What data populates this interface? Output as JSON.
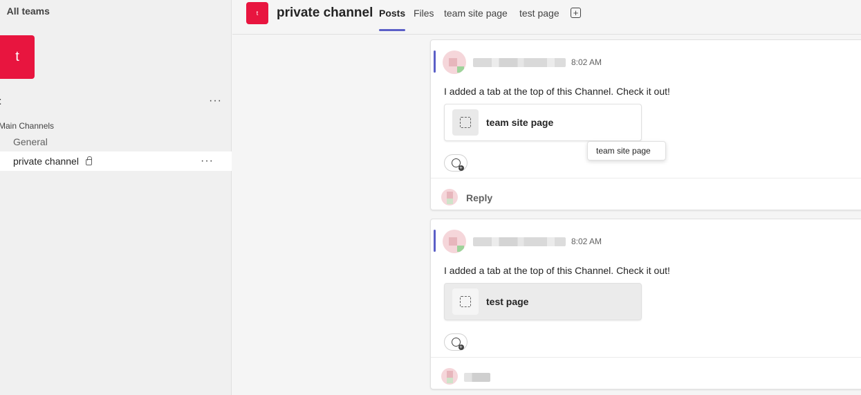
{
  "sidebar": {
    "back_label": "All teams",
    "team_initial": "t",
    "team_name": "st",
    "more": "···",
    "section": "Main Channels",
    "channels": [
      {
        "name": "General"
      },
      {
        "name": "private channel",
        "more": "···"
      }
    ]
  },
  "header": {
    "avatar_initial": "t",
    "title": "private channel",
    "tabs": [
      {
        "label": "Posts"
      },
      {
        "label": "Files"
      },
      {
        "label": "team site page"
      },
      {
        "label": "test page"
      }
    ],
    "add_tab_icon": "+"
  },
  "posts": [
    {
      "time": "8:02 AM",
      "message": "I added a tab at the top of this Channel. Check it out!",
      "tab_card": "team site page",
      "reply_label": "Reply"
    },
    {
      "time": "8:02 AM",
      "message": "I added a tab at the top of this Channel. Check it out!",
      "tab_card": "test page"
    }
  ],
  "tooltip": "team site page",
  "colors": {
    "team_red": "#e8153f",
    "accent": "#5b5fc7",
    "presence": "#13a10e"
  }
}
